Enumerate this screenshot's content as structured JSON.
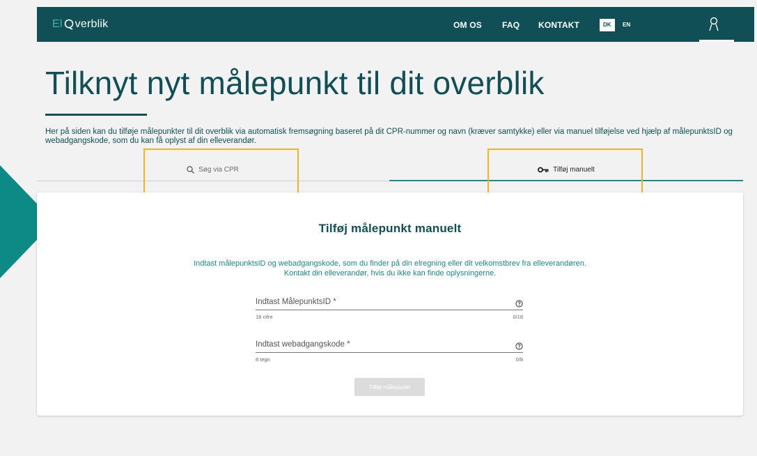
{
  "header": {
    "logo_el": "El",
    "logo_rest": "verblik",
    "nav": [
      "OM OS",
      "FAQ",
      "KONTAKT"
    ],
    "lang_active": "DK",
    "lang_other": "EN",
    "user_icon": "user-icon"
  },
  "page": {
    "title": "Tilknyt nyt målepunkt til dit overblik",
    "intro": "Her på siden kan du tilføje målepunkter til dit overblik via automatisk fremsøgning baseret på dit CPR-nummer og navn (kræver samtykke) eller via manuel tilføjelse ved hjælp af målepunktsID og webadgangskode, som du kan få oplyst af din elleverandør."
  },
  "tabs": [
    {
      "label": "Søg via CPR",
      "icon": "search-icon"
    },
    {
      "label": "Tilføj manuelt",
      "icon": "key-icon"
    }
  ],
  "card": {
    "title": "Tilføj målepunkt manuelt",
    "desc_line1": "Indtast målepunktsID og webadgangskode, som du finder på din elregning eller dit velkomstbrev fra elleverandøren.",
    "desc_line2": "Kontakt din elleverandør, hvis du ikke kan finde oplysningerne.",
    "fields": [
      {
        "label": "Indtast MålepunktsID *",
        "hint": "18 cifre",
        "counter": "0/18"
      },
      {
        "label": "Indtast webadgangskode *",
        "hint": "8 tegn",
        "counter": "0/8"
      }
    ],
    "submit_label": "Tilføj målepunkt"
  },
  "colors": {
    "header_bg": "#0f4f55",
    "accent": "#1b8a86",
    "highlight": "#f0b323",
    "arrow": "#0e8a86"
  }
}
